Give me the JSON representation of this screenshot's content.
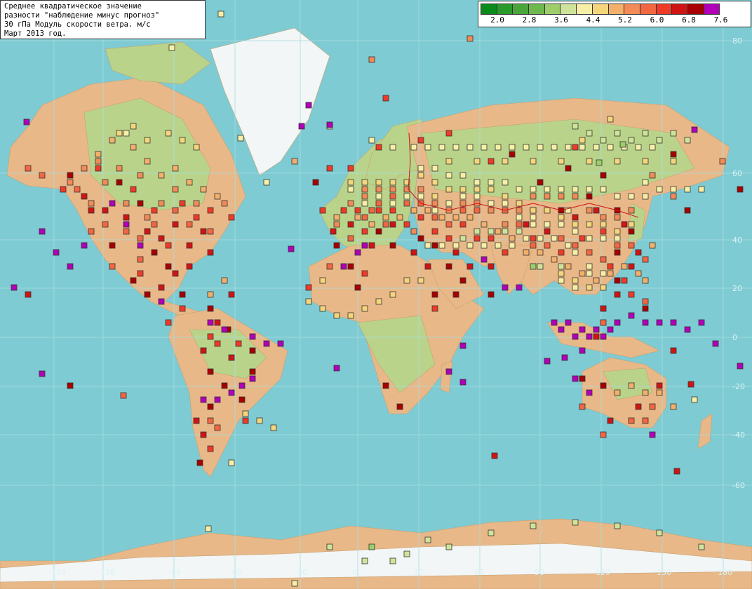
{
  "title": {
    "line1": "Среднее квадратическое значение",
    "line2": "разности \"наблюдение минус прогноз\"",
    "line3": "30 гПа Модуль скорости ветра. м/с",
    "line4": "Март 2013 год."
  },
  "legend": {
    "colors": [
      "#0a8a1a",
      "#2a9a2a",
      "#4aa63a",
      "#6eb84e",
      "#9dce6a",
      "#cfe49a",
      "#f7efa6",
      "#f5d67c",
      "#f4b06a",
      "#f28b56",
      "#f36642",
      "#f03a28",
      "#d01414",
      "#a80000",
      "#b000b8"
    ],
    "labels": [
      "2.0",
      "2.8",
      "3.6",
      "4.4",
      "5.2",
      "6.0",
      "6.8",
      "7.6"
    ]
  },
  "grid": {
    "lon_labels": [
      "-150",
      "-120",
      "-90",
      "-60",
      "-30",
      "0",
      "30",
      "60",
      "90",
      "120",
      "150",
      "180"
    ],
    "lat_labels": [
      "60",
      "40",
      "20",
      "0",
      "-20",
      "-40",
      "-60",
      "80"
    ]
  },
  "map_colors": {
    "ocean": "#7ecbd3",
    "land": "#e8b888",
    "land_green": "#b9d48a",
    "ice": "#f2f6f6"
  }
}
